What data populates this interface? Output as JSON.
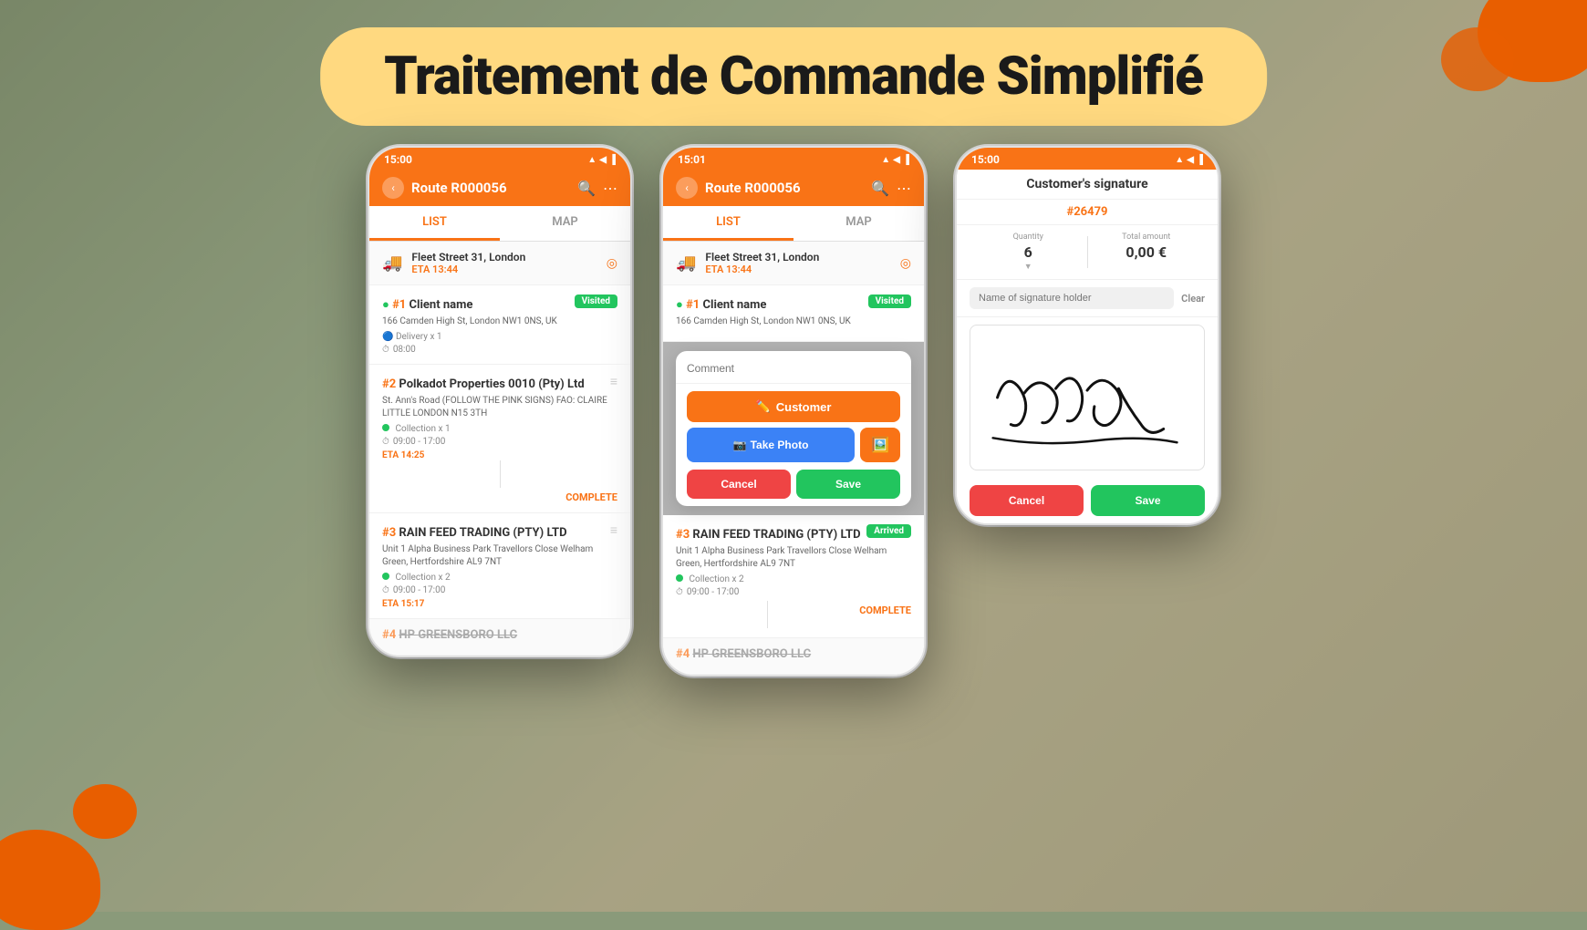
{
  "background": {
    "gradient_start": "#7a8a6a",
    "gradient_end": "#c8b898"
  },
  "title_banner": {
    "text": "Traitement de Commande Simplifié",
    "bg_color": "#ffd980"
  },
  "phones": [
    {
      "id": "phone1",
      "status_bar": {
        "time": "15:00",
        "icons": "▲ ◀ ☁ ◀◀"
      },
      "nav": {
        "route": "Route R000056",
        "back_icon": "‹",
        "search_icon": "🔍",
        "more_icon": "⋯"
      },
      "tabs": [
        "LIST",
        "MAP"
      ],
      "active_tab": "LIST",
      "location": {
        "name": "Fleet Street 31, London",
        "eta": "ETA 13:44"
      },
      "stops": [
        {
          "number": "#1",
          "name": "Client name",
          "badge": "Visited",
          "badge_type": "visited",
          "address": "166 Camden High St, London NW1 0NS, UK",
          "type": "Delivery x 1",
          "time": "08:00",
          "eta": null,
          "complete": null
        },
        {
          "number": "#2",
          "name": "Polkadot Properties 0010 (Pty) Ltd",
          "badge": null,
          "address": "St. Ann's Road (FOLLOW THE PINK SIGNS) FAO: CLAIRE LITTLE LONDON N15 3TH",
          "type": "Collection x 1",
          "time": "09:00 - 17:00",
          "eta": "ETA 14:25",
          "complete": "COMPLETE"
        },
        {
          "number": "#3",
          "name": "RAIN FEED TRADING (PTY) LTD",
          "badge": null,
          "address": "Unit 1 Alpha Business Park Travellors Close Welham Green, Hertfordshire AL9 7NT",
          "type": "Collection x 2",
          "time": "09:00 - 17:00",
          "eta": "ETA 15:17",
          "complete": null
        },
        {
          "number": "#4",
          "name": "HP GREENSBORO LLC",
          "badge": null,
          "address": "",
          "type": "",
          "time": "",
          "eta": null,
          "complete": null
        }
      ]
    },
    {
      "id": "phone2",
      "status_bar": {
        "time": "15:01",
        "icons": "▲ ◀ ☁ ◀◀"
      },
      "nav": {
        "route": "Route R000056",
        "back_icon": "‹",
        "search_icon": "🔍",
        "more_icon": "⋯"
      },
      "tabs": [
        "LIST",
        "MAP"
      ],
      "active_tab": "LIST",
      "location": {
        "name": "Fleet Street 31, London",
        "eta": "ETA 13:44"
      },
      "stops_above_modal": [
        {
          "number": "#1",
          "name": "Client name",
          "badge": "Visited",
          "address": "166 Camden High St, London NW1 0NS, UK"
        }
      ],
      "modal": {
        "comment_placeholder": "Comment",
        "customer_btn": "Customer",
        "photo_btn": "Take Photo",
        "cancel_btn": "Cancel",
        "save_btn": "Save"
      },
      "stops_below_modal": [
        {
          "number": "#3",
          "name": "RAIN FEED TRADING (PTY) LTD",
          "badge": "Arrived",
          "badge_type": "arrived",
          "address": "Unit 1 Alpha Business Park Travellors Close Welham Green, Hertfordshire AL9 7NT",
          "type": "Collection x 2",
          "time": "09:00 - 17:00",
          "complete": "COMPLETE"
        },
        {
          "number": "#4",
          "name": "HP GREENSBORO LLC",
          "badge": null,
          "address": ""
        }
      ]
    },
    {
      "id": "phone3",
      "status_bar": {
        "time": "15:00",
        "icons": "▲ ◀ ☁ ◀◀"
      },
      "nav": {
        "title": "Customer's signature"
      },
      "signature": {
        "order": "#26479",
        "quantity_label": "Quantity",
        "quantity_value": "6",
        "total_label": "Total amount",
        "total_value": "0,00 €",
        "name_placeholder": "Name of signature holder",
        "clear_btn": "Clear",
        "cancel_btn": "Cancel",
        "save_btn": "Save"
      }
    }
  ]
}
